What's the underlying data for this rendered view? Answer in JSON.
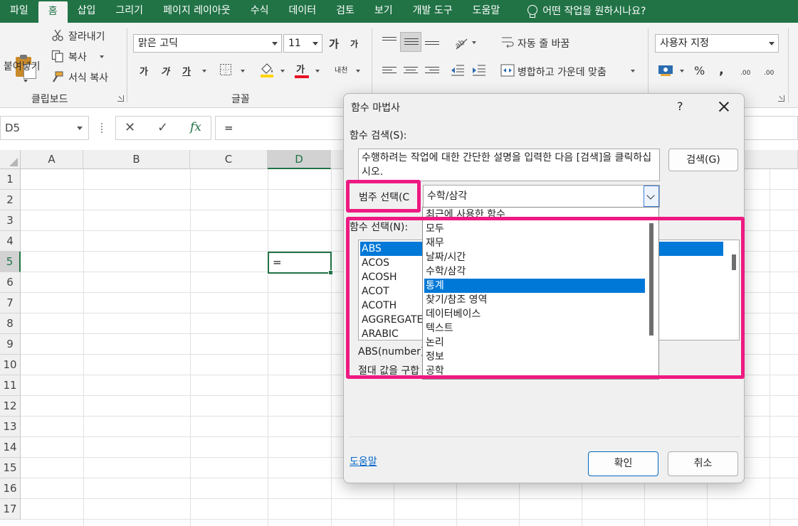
{
  "ribbon_tabs": [
    "파일",
    "홈",
    "삽입",
    "그리기",
    "페이지 레이아웃",
    "수식",
    "데이터",
    "검토",
    "보기",
    "개발 도구",
    "도움말"
  ],
  "tell_me": "어떤 작업을 원하시나요?",
  "clipboard": {
    "paste": "붙여넣기",
    "cut": "잘라내기",
    "copy": "복사",
    "format_painter": "서식 복사",
    "group": "클립보드"
  },
  "font": {
    "name": "맑은 고딕",
    "size": "11",
    "bold": "가",
    "italic": "가",
    "underline": "가",
    "color_a": "가",
    "grow": "가",
    "shrink": "가",
    "phonetic": "내천",
    "group": "글꼴"
  },
  "alignment": {
    "wrap": "자동 줄 바꿈",
    "merge": "병합하고 가운데 맞춤"
  },
  "number": {
    "format": "사용자 지정",
    "percent": "%",
    "comma": ",",
    "inc_decimal": ".00",
    "dec_decimal": ".00"
  },
  "formula_bar": {
    "name_box": "D5",
    "formula": "=",
    "cancel": "✕",
    "enter": "✓",
    "fx": "fx"
  },
  "grid": {
    "columns": [
      "A",
      "B",
      "C",
      "D"
    ],
    "rows": [
      "1",
      "2",
      "3",
      "4",
      "5",
      "6",
      "7",
      "8",
      "9",
      "10",
      "11",
      "12",
      "13",
      "14",
      "15",
      "16",
      "17"
    ],
    "active_cell_value": "="
  },
  "dialog": {
    "title": "함수 마법사",
    "help": "?",
    "search_label": "함수 검색(S):",
    "search_text": "수행하려는 작업에 대한 간단한 설명을 입력한 다음 [검색]을 클릭하십시오.",
    "search_button": "검색(G)",
    "category_label": "범주 선택(C",
    "category_value": "수학/삼각",
    "function_label": "함수 선택(N):",
    "functions": [
      "ABS",
      "ACOS",
      "ACOSH",
      "ACOT",
      "ACOTH",
      "AGGREGATE",
      "ARABIC"
    ],
    "selected_function": "ABS",
    "syntax": "ABS(number)",
    "description": "절대 값을 구합",
    "help_link": "도움말",
    "ok": "확인",
    "cancel": "취소"
  },
  "category_options": [
    "최근에 사용한 함수",
    "모두",
    "재무",
    "날짜/시간",
    "수학/삼각",
    "통계",
    "찾기/참조 영역",
    "데이터베이스",
    "텍스트",
    "논리",
    "정보",
    "공학"
  ],
  "category_highlighted": "통계",
  "colors": {
    "excel_green": "#217346",
    "selection_blue": "#0078d7",
    "highlight_pink": "#ee1982",
    "link_blue": "#0066cc"
  }
}
